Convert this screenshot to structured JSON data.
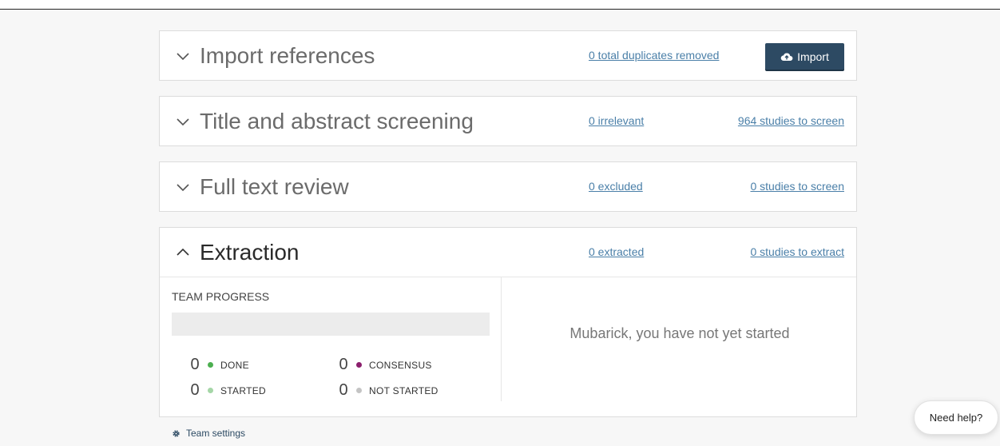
{
  "sections": {
    "import": {
      "title": "Import references",
      "duplicates_link": "0 total duplicates removed",
      "import_button": "Import",
      "chevron_icon": "chevron-down-icon",
      "button_icon": "cloud-upload-icon"
    },
    "screening": {
      "title": "Title and abstract screening",
      "left_link": "0 irrelevant",
      "right_link": "964 studies to screen",
      "chevron_icon": "chevron-down-icon"
    },
    "full_text": {
      "title": "Full text review",
      "left_link": "0 excluded",
      "right_link": "0 studies to screen",
      "chevron_icon": "chevron-down-icon"
    },
    "extraction": {
      "title": "Extraction",
      "left_link": "0 extracted",
      "right_link": "0 studies to extract",
      "chevron_icon": "chevron-up-icon",
      "team_progress": {
        "label": "TEAM PROGRESS",
        "progress_fraction": 0,
        "stats": [
          {
            "count": "0",
            "label": "DONE",
            "color": "#4caf50"
          },
          {
            "count": "0",
            "label": "CONSENSUS",
            "color": "#8b1f6d"
          },
          {
            "count": "0",
            "label": "STARTED",
            "color": "#a5d6a7"
          },
          {
            "count": "0",
            "label": "NOT STARTED",
            "color": "#c4c4c4"
          }
        ]
      },
      "status_message": "Mubarick, you have not yet started",
      "team_settings": {
        "label": "Team settings",
        "icon": "gear-icon"
      }
    }
  },
  "help_button": "Need help?",
  "colors": {
    "link": "#4a7fa8",
    "button_bg": "#2d4a63"
  }
}
